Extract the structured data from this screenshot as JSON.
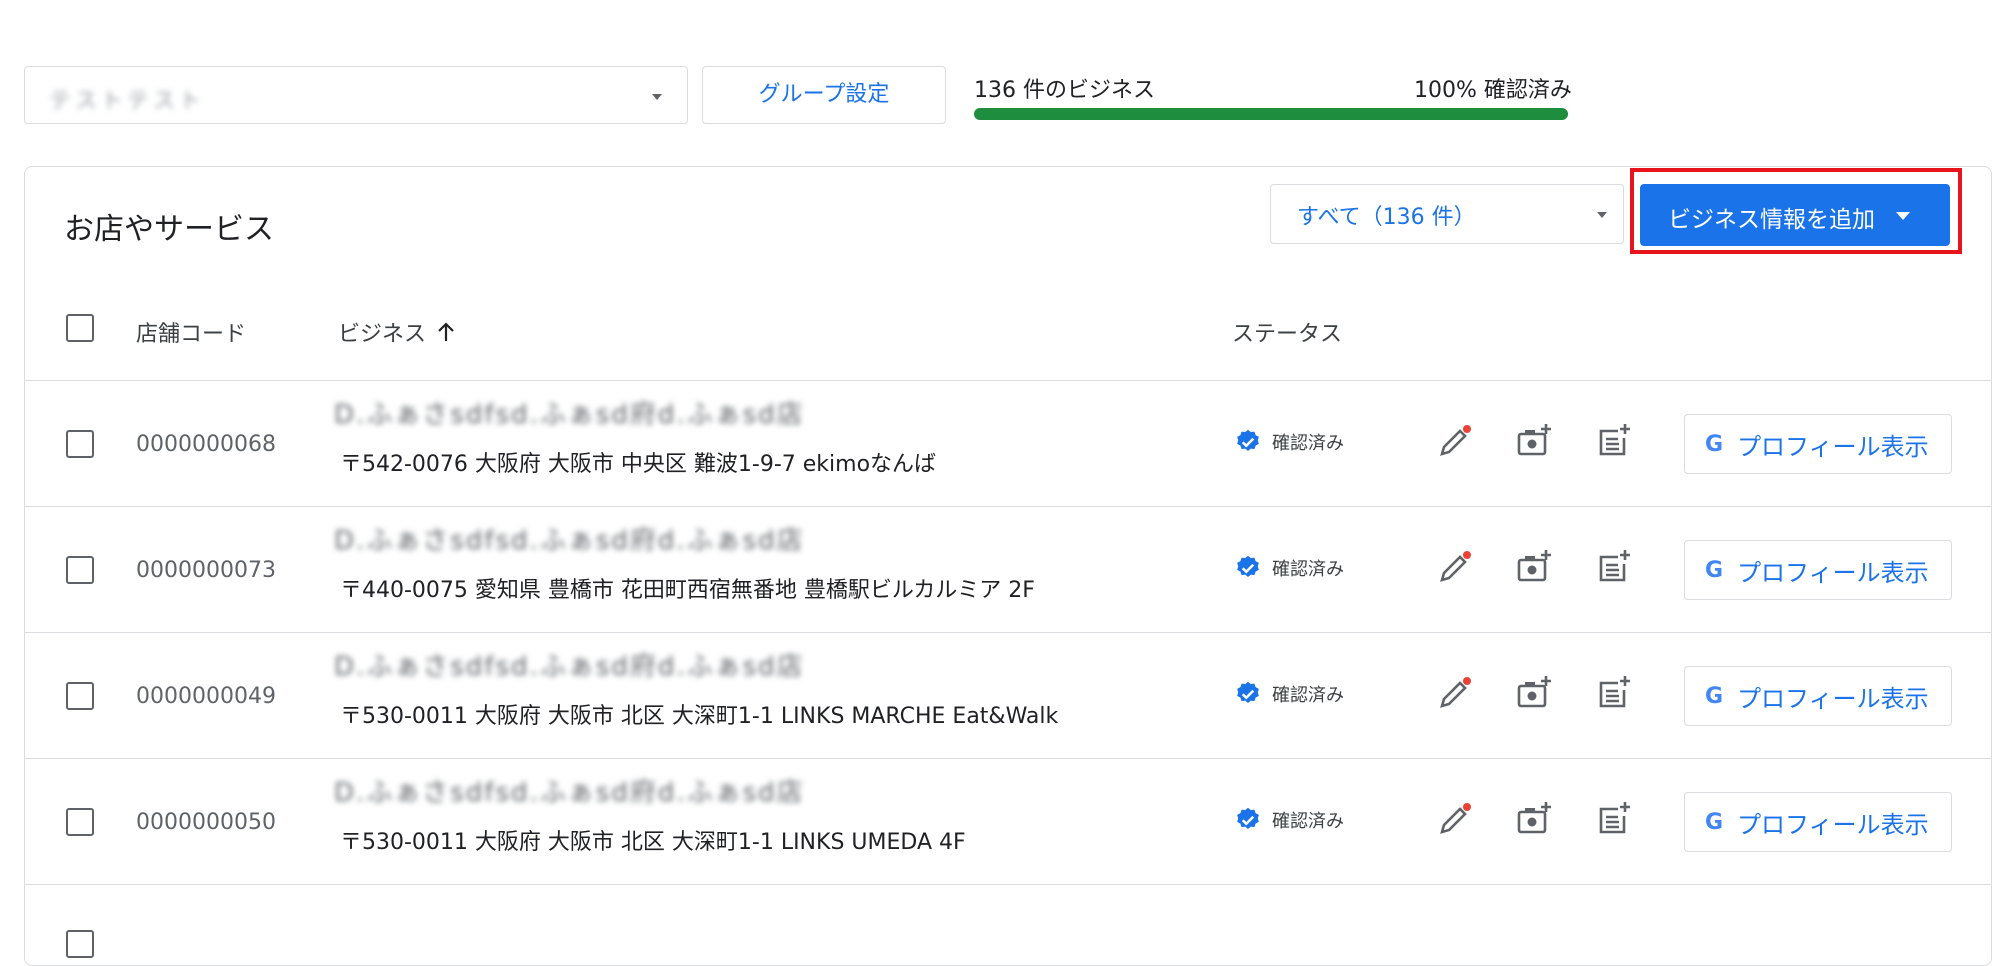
{
  "top": {
    "group_value": "テストテスト",
    "group_settings_label": "グループ設定",
    "business_count": "136 件のビジネス",
    "verified_percent": "100% 確認済み",
    "progress": 1.0
  },
  "card": {
    "title": "お店やサービス",
    "filter_value": "すべて（136 件）",
    "add_button_label": "ビジネス情報を追加"
  },
  "table": {
    "headers": {
      "store_code": "店舗コード",
      "business": "ビジネス",
      "status": "ステータス"
    },
    "rows": [
      {
        "code": "0000000068",
        "name": "D.ふぁさsdfsd.ふぁsd府d.ふぁsd店",
        "address": "〒542-0076 大阪府 大阪市 中央区 難波1-9-7 ekimoなんば",
        "status": "確認済み",
        "profile_label": "プロフィール表示"
      },
      {
        "code": "0000000073",
        "name": "D.ふぁさsdfsd.ふぁsd府d.ふぁsd店",
        "address": "〒440-0075 愛知県 豊橋市 花田町西宿無番地 豊橋駅ビルカルミア 2F",
        "status": "確認済み",
        "profile_label": "プロフィール表示"
      },
      {
        "code": "0000000049",
        "name": "D.ふぁさsdfsd.ふぁsd府d.ふぁsd店",
        "address": "〒530-0011 大阪府 大阪市 北区 大深町1-1 LINKS MARCHE Eat&Walk",
        "status": "確認済み",
        "profile_label": "プロフィール表示"
      },
      {
        "code": "0000000050",
        "name": "D.ふぁさsdfsd.ふぁsd府d.ふぁsd店",
        "address": "〒530-0011 大阪府 大阪市 北区 大深町1-1 LINKS UMEDA 4F",
        "status": "確認済み",
        "profile_label": "プロフィール表示"
      }
    ]
  },
  "colors": {
    "primary": "#1a73e8",
    "progress": "#1e8e3e",
    "highlight": "#e8141b",
    "edit_dot": "#ea4335"
  }
}
